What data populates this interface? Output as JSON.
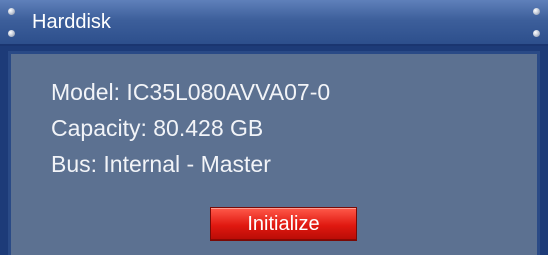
{
  "window": {
    "title": "Harddisk"
  },
  "info": {
    "model": "Model: IC35L080AVVA07-0",
    "capacity": "Capacity: 80.428 GB",
    "bus": "Bus: Internal - Master"
  },
  "actions": {
    "initialize_label": "Initialize"
  },
  "colors": {
    "frame": "#1d3b78",
    "panel": "#5c7191",
    "button": "#e01810"
  }
}
